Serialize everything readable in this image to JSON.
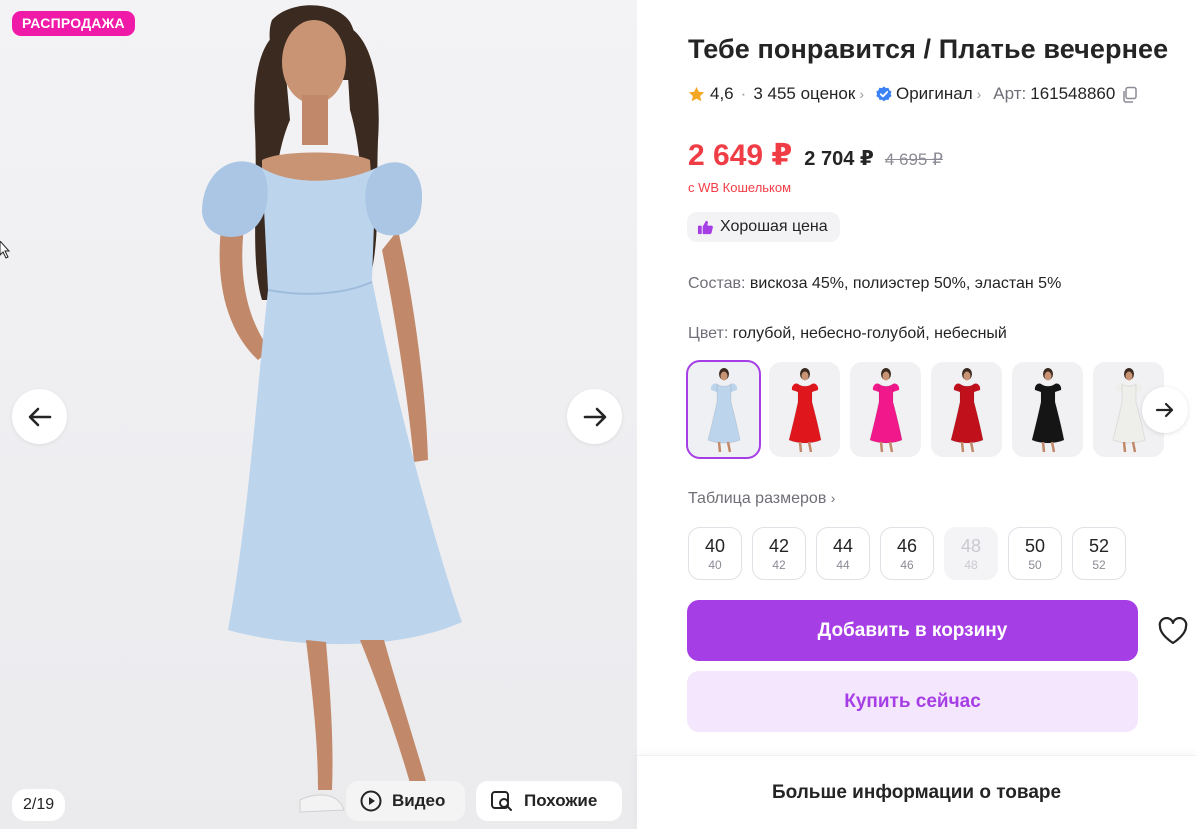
{
  "gallery": {
    "badge": "РАСПРОДАЖА",
    "counter": "2/19",
    "video_label": "Видео",
    "similar_label": "Похожие",
    "dress_color": "#bcd4ec"
  },
  "product": {
    "title": "Тебе понравится / Платье вечернее",
    "rating": "4,6",
    "reviews": "3 455 оценок",
    "original_label": "Оригинал",
    "article_label": "Арт:",
    "article_value": "161548860",
    "price_main": "2 649 ₽",
    "price_second": "2 704 ₽",
    "price_old": "4 695 ₽",
    "wallet_note": "с WB Кошельком",
    "good_price": "Хорошая цена",
    "composition_label": "Состав:",
    "composition_value": "вискоза 45%, полиэстер 50%, эластан 5%",
    "color_label": "Цвет:",
    "color_value": "голубой, небесно-голубой, небесный",
    "size_table_link": "Таблица размеров",
    "add_to_cart": "Добавить в корзину",
    "buy_now": "Купить сейчас",
    "more_info": "Больше информации о товаре"
  },
  "swatch_colors": [
    "#bcd4ec",
    "#e0161d",
    "#f0188a",
    "#c0101c",
    "#151515",
    "#eeeeea"
  ],
  "sizes": [
    {
      "main": "40",
      "sub": "40"
    },
    {
      "main": "42",
      "sub": "42"
    },
    {
      "main": "44",
      "sub": "44"
    },
    {
      "main": "46",
      "sub": "46"
    },
    {
      "main": "48",
      "sub": "48"
    },
    {
      "main": "50",
      "sub": "50"
    },
    {
      "main": "52",
      "sub": "52"
    }
  ],
  "colors": {
    "accent": "#a63ee6",
    "price_red": "#f03d45",
    "badge_pink": "#f01aa8",
    "verified_blue": "#3b82f6",
    "star": "#f5a623"
  }
}
